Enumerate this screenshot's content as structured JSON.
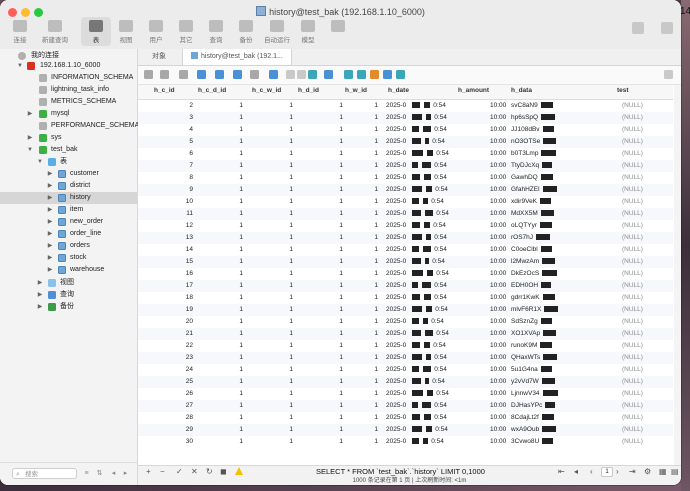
{
  "window": {
    "title": "history@test_bak (192.168.1.10_6000)"
  },
  "toolbar": {
    "buttons": [
      {
        "label": "连接"
      },
      {
        "label": "新建查询"
      },
      {
        "label": "表"
      },
      {
        "label": "视图"
      },
      {
        "label": "用户"
      },
      {
        "label": "其它"
      },
      {
        "label": "查询"
      },
      {
        "label": "备份"
      },
      {
        "label": "自动运行"
      },
      {
        "label": "模型"
      },
      {
        "label": ""
      }
    ],
    "active": "表"
  },
  "sidebar": {
    "my_connections": "我的连接",
    "connection": "192.168.1.10_6000",
    "databases": [
      "INFORMATION_SCHEMA",
      "lightning_task_info",
      "METRICS_SCHEMA",
      "mysql",
      "PERFORMANCE_SCHEMA",
      "sys",
      "test_bak"
    ],
    "tables_folder": "表",
    "tables": [
      "customer",
      "district",
      "history",
      "item",
      "new_order",
      "order_line",
      "orders",
      "stock",
      "warehouse"
    ],
    "selected_table": "history",
    "views_folder": "视图",
    "queries_folder": "查询",
    "backups_folder": "备份",
    "search_placeholder": "搜索"
  },
  "tabs": [
    {
      "label": "对象"
    },
    {
      "label": "history@test_bak (192.1..."
    }
  ],
  "grid": {
    "columns": [
      "h_c_id",
      "h_c_d_id",
      "h_c_w_id",
      "h_d_id",
      "h_w_id",
      "h_date",
      "h_amount",
      "h_data",
      "test"
    ],
    "rows": [
      {
        "id": "2",
        "f1": "1",
        "f2": "1",
        "f3": "1",
        "f4": "1",
        "date": "2025-0",
        "dtime": "0:54",
        "time": "10:00",
        "data": "svC8aN9",
        "null": "(NULL)"
      },
      {
        "id": "3",
        "f1": "1",
        "f2": "1",
        "f3": "1",
        "f4": "1",
        "date": "2025-0",
        "dtime": "0:54",
        "time": "10:00",
        "data": "hp6sSpQ",
        "null": "(NULL)"
      },
      {
        "id": "4",
        "f1": "1",
        "f2": "1",
        "f3": "1",
        "f4": "1",
        "date": "2025-0",
        "dtime": "0:54",
        "time": "10:00",
        "data": "JJ108dBv",
        "null": "(NULL)"
      },
      {
        "id": "5",
        "f1": "1",
        "f2": "1",
        "f3": "1",
        "f4": "1",
        "date": "2025-0",
        "dtime": "0:54",
        "time": "10:00",
        "data": "nO3OTSe",
        "null": "(NULL)"
      },
      {
        "id": "6",
        "f1": "1",
        "f2": "1",
        "f3": "1",
        "f4": "1",
        "date": "2025-0",
        "dtime": "0:54",
        "time": "10:00",
        "data": "b0T3Lmp",
        "null": "(NULL)"
      },
      {
        "id": "7",
        "f1": "1",
        "f2": "1",
        "f3": "1",
        "f4": "1",
        "date": "2025-0",
        "dtime": "0:54",
        "time": "10:00",
        "data": "TtyDJcXq",
        "null": "(NULL)"
      },
      {
        "id": "8",
        "f1": "1",
        "f2": "1",
        "f3": "1",
        "f4": "1",
        "date": "2025-0",
        "dtime": "0:54",
        "time": "10:00",
        "data": "GawhDQ",
        "null": "(NULL)"
      },
      {
        "id": "9",
        "f1": "1",
        "f2": "1",
        "f3": "1",
        "f4": "1",
        "date": "2025-0",
        "dtime": "0:54",
        "time": "10:00",
        "data": "GfahHZEl",
        "null": "(NULL)"
      },
      {
        "id": "10",
        "f1": "1",
        "f2": "1",
        "f3": "1",
        "f4": "1",
        "date": "2025-0",
        "dtime": "0:54",
        "time": "10:00",
        "data": "xdir9VeK",
        "null": "(NULL)"
      },
      {
        "id": "11",
        "f1": "1",
        "f2": "1",
        "f3": "1",
        "f4": "1",
        "date": "2025-0",
        "dtime": "0:54",
        "time": "10:00",
        "data": "MdXX5M",
        "null": "(NULL)"
      },
      {
        "id": "12",
        "f1": "1",
        "f2": "1",
        "f3": "1",
        "f4": "1",
        "date": "2025-0",
        "dtime": "0:54",
        "time": "10:00",
        "data": "oLQTYyr",
        "null": "(NULL)"
      },
      {
        "id": "13",
        "f1": "1",
        "f2": "1",
        "f3": "1",
        "f4": "1",
        "date": "2025-0",
        "dtime": "0:54",
        "time": "10:00",
        "data": "rOS7hJ",
        "null": "(NULL)"
      },
      {
        "id": "14",
        "f1": "1",
        "f2": "1",
        "f3": "1",
        "f4": "1",
        "date": "2025-0",
        "dtime": "0:54",
        "time": "10:00",
        "data": "C0oeClbl",
        "null": "(NULL)"
      },
      {
        "id": "15",
        "f1": "1",
        "f2": "1",
        "f3": "1",
        "f4": "1",
        "date": "2025-0",
        "dtime": "0:54",
        "time": "10:00",
        "data": "l2MwzAm",
        "null": "(NULL)"
      },
      {
        "id": "16",
        "f1": "1",
        "f2": "1",
        "f3": "1",
        "f4": "1",
        "date": "2025-0",
        "dtime": "0:54",
        "time": "10:00",
        "data": "DkEzOcS",
        "null": "(NULL)"
      },
      {
        "id": "17",
        "f1": "1",
        "f2": "1",
        "f3": "1",
        "f4": "1",
        "date": "2025-0",
        "dtime": "0:54",
        "time": "10:00",
        "data": "EDH0OH",
        "null": "(NULL)"
      },
      {
        "id": "18",
        "f1": "1",
        "f2": "1",
        "f3": "1",
        "f4": "1",
        "date": "2025-0",
        "dtime": "0:54",
        "time": "10:00",
        "data": "gdrr1KwK",
        "null": "(NULL)"
      },
      {
        "id": "19",
        "f1": "1",
        "f2": "1",
        "f3": "1",
        "f4": "1",
        "date": "2025-0",
        "dtime": "0:54",
        "time": "10:00",
        "data": "mlvF6R1X",
        "null": "(NULL)"
      },
      {
        "id": "20",
        "f1": "1",
        "f2": "1",
        "f3": "1",
        "f4": "1",
        "date": "2025-0",
        "dtime": "0:54",
        "time": "10:00",
        "data": "SdSznZg",
        "null": "(NULL)"
      },
      {
        "id": "21",
        "f1": "1",
        "f2": "1",
        "f3": "1",
        "f4": "1",
        "date": "2025-0",
        "dtime": "0:54",
        "time": "10:00",
        "data": "XO1XVAp",
        "null": "(NULL)"
      },
      {
        "id": "22",
        "f1": "1",
        "f2": "1",
        "f3": "1",
        "f4": "1",
        "date": "2025-0",
        "dtime": "0:54",
        "time": "10:00",
        "data": "runoK9M",
        "null": "(NULL)"
      },
      {
        "id": "23",
        "f1": "1",
        "f2": "1",
        "f3": "1",
        "f4": "1",
        "date": "2025-0",
        "dtime": "0:54",
        "time": "10:00",
        "data": "QHaxWTs",
        "null": "(NULL)"
      },
      {
        "id": "24",
        "f1": "1",
        "f2": "1",
        "f3": "1",
        "f4": "1",
        "date": "2025-0",
        "dtime": "0:54",
        "time": "10:00",
        "data": "5u1G4na",
        "null": "(NULL)"
      },
      {
        "id": "25",
        "f1": "1",
        "f2": "1",
        "f3": "1",
        "f4": "1",
        "date": "2025-0",
        "dtime": "0:54",
        "time": "10:00",
        "data": "y2vVd7W",
        "null": "(NULL)"
      },
      {
        "id": "26",
        "f1": "1",
        "f2": "1",
        "f3": "1",
        "f4": "1",
        "date": "2025-0",
        "dtime": "0:54",
        "time": "10:00",
        "data": "LjnnwV34",
        "null": "(NULL)"
      },
      {
        "id": "27",
        "f1": "1",
        "f2": "1",
        "f3": "1",
        "f4": "1",
        "date": "2025-0",
        "dtime": "0:54",
        "time": "10:00",
        "data": "DJHasYPc",
        "null": "(NULL)"
      },
      {
        "id": "28",
        "f1": "1",
        "f2": "1",
        "f3": "1",
        "f4": "1",
        "date": "2025-0",
        "dtime": "0:54",
        "time": "10:00",
        "data": "8CdajLt2f",
        "null": "(NULL)"
      },
      {
        "id": "29",
        "f1": "1",
        "f2": "1",
        "f3": "1",
        "f4": "1",
        "date": "2025-0",
        "dtime": "0:54",
        "time": "10:00",
        "data": "wxA9Oub",
        "null": "(NULL)"
      },
      {
        "id": "30",
        "f1": "1",
        "f2": "1",
        "f3": "1",
        "f4": "1",
        "date": "2025-0",
        "dtime": "0:54",
        "time": "10:00",
        "data": "3Cvwo8U",
        "null": "(NULL)"
      }
    ]
  },
  "status": {
    "sql": "SELECT * FROM `test_bak`.`history` LIMIT 0,1000",
    "page": "1",
    "summary": "1000 条记录在第 1 页  |  上次刷新时间: <1m"
  },
  "desktop": {
    "edge_text": "14"
  }
}
